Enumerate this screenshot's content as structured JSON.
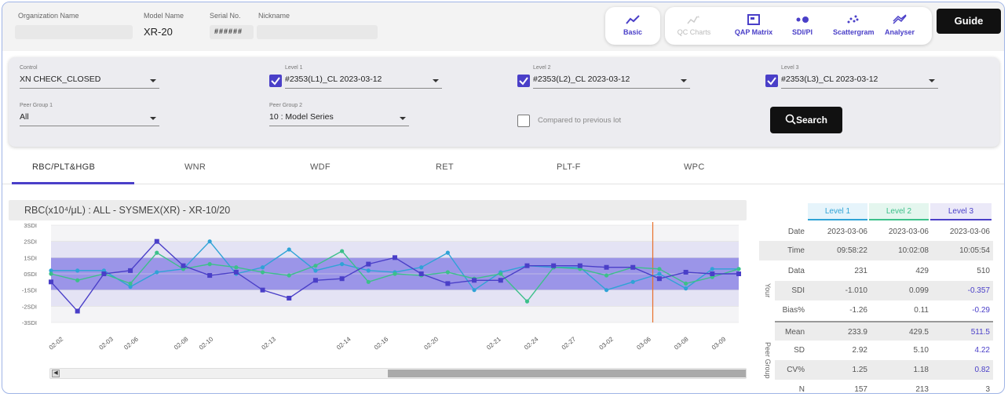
{
  "header": {
    "org_label": "Organization Name",
    "model_label": "Model Name",
    "model_value": "XR-20",
    "serial_label": "Serial No.",
    "serial_value": "######",
    "nickname_label": "Nickname",
    "nav": [
      {
        "label": "Basic",
        "icon": "line-chart-icon",
        "enabled": true
      },
      {
        "label": "QC Charts",
        "icon": "star-chart-icon",
        "enabled": false
      },
      {
        "label": "QAP Matrix",
        "icon": "matrix-icon",
        "enabled": true
      },
      {
        "label": "SDI/PI",
        "icon": "sdi-icon",
        "enabled": true
      },
      {
        "label": "Scattergram",
        "icon": "scatter-icon",
        "enabled": true
      },
      {
        "label": "Analyser",
        "icon": "analyser-icon",
        "enabled": true
      }
    ],
    "guide_label": "Guide"
  },
  "filter": {
    "control_label": "Control",
    "control_value": "XN CHECK_CLOSED",
    "level1_label": "Level 1",
    "level1_value": "#2353(L1)_CL   2023-03-12",
    "level2_label": "Level 2",
    "level2_value": "#2353(L2)_CL   2023-03-12",
    "level3_label": "Level 3",
    "level3_value": "#2353(L3)_CL   2023-03-12",
    "peer1_label": "Peer Group 1",
    "peer1_value": "All",
    "peer2_label": "Peer Group 2",
    "peer2_value": "10 : Model Series",
    "compare_label": "Compared to previous lot",
    "search_label": "Search"
  },
  "tabs": [
    "RBC/PLT&HGB",
    "WNR",
    "WDF",
    "RET",
    "PLT-F",
    "WPC"
  ],
  "chart_title": "RBC(x10⁴/μL) : ALL - SYSMEX(XR) - XR-10/20",
  "colors": {
    "accent": "#4a3fc8",
    "level1": "#2fa3d6",
    "level2": "#3cc08a",
    "level3": "#4a3fc8",
    "marker": "#e8702a",
    "band_inner": "#9b95e8",
    "band_outer": "#e4e3f4"
  },
  "chart_data": {
    "type": "line",
    "y_ticks": [
      "3SDI",
      "2SDI",
      "1SDI",
      "0SDI",
      "-1SDI",
      "-2SDI",
      "-3SDI"
    ],
    "ylim": [
      -3,
      3
    ],
    "x_labels": [
      "02-02",
      "02-03",
      "02-06",
      "02-08",
      "02-10",
      "02-13",
      "02-14",
      "02-16",
      "02-20",
      "02-21",
      "02-24",
      "02-27",
      "03-02",
      "03-06",
      "03-08",
      "03-09"
    ],
    "highlight_label": "03-06",
    "series": [
      {
        "name": "Level 1",
        "values": [
          0.2,
          0.2,
          0.2,
          -0.8,
          0.1,
          0.3,
          2.0,
          0.0,
          0.4,
          1.5,
          0.2,
          0.6,
          0.2,
          0.1,
          0.4,
          1.3,
          -1.0,
          0.1,
          0.5,
          0.4,
          0.4,
          -1.0,
          -0.5,
          0.0,
          -0.9,
          0.3,
          0.3
        ]
      },
      {
        "name": "Level 2",
        "values": [
          0.0,
          -0.4,
          0.0,
          -0.6,
          1.3,
          0.3,
          0.6,
          0.4,
          0.1,
          -0.1,
          0.5,
          1.4,
          -0.5,
          0.0,
          -0.1,
          0.1,
          -0.3,
          0.0,
          -1.7,
          0.4,
          0.3,
          -0.1,
          0.4,
          0.3,
          -0.6,
          -0.2,
          0.3
        ]
      },
      {
        "name": "Level 3",
        "values": [
          -0.5,
          -2.3,
          0.0,
          0.2,
          2.0,
          0.5,
          -0.1,
          0.1,
          -1.0,
          -1.5,
          -0.4,
          -0.3,
          0.6,
          1.0,
          0.0,
          -0.6,
          -0.4,
          -0.4,
          0.5,
          0.5,
          0.5,
          0.4,
          0.4,
          -0.3,
          0.1,
          0.0,
          0.0
        ]
      }
    ]
  },
  "stats": {
    "levels": [
      "Level 1",
      "Level 2",
      "Level 3"
    ],
    "date_label": "Date",
    "dates": [
      "2023-03-06",
      "2023-03-06",
      "2023-03-06"
    ],
    "time_label": "Time",
    "times": [
      "09:58:22",
      "10:02:08",
      "10:05:54"
    ],
    "your_label": "Your",
    "data_label": "Data",
    "data": [
      "231",
      "429",
      "510"
    ],
    "sdi_label": "SDI",
    "sdi": [
      "-1.010",
      "0.099",
      "-0.357"
    ],
    "bias_label": "Bias%",
    "bias": [
      "-1.26",
      "0.11",
      "-0.29"
    ],
    "peer_label": "Peer Group",
    "mean_label": "Mean",
    "mean": [
      "233.9",
      "429.5",
      "511.5"
    ],
    "sd_label": "SD",
    "sd": [
      "2.92",
      "5.10",
      "4.22"
    ],
    "cv_label": "CV%",
    "cv": [
      "1.25",
      "1.18",
      "0.82"
    ],
    "n_label": "N",
    "n": [
      "157",
      "213",
      "3"
    ]
  }
}
